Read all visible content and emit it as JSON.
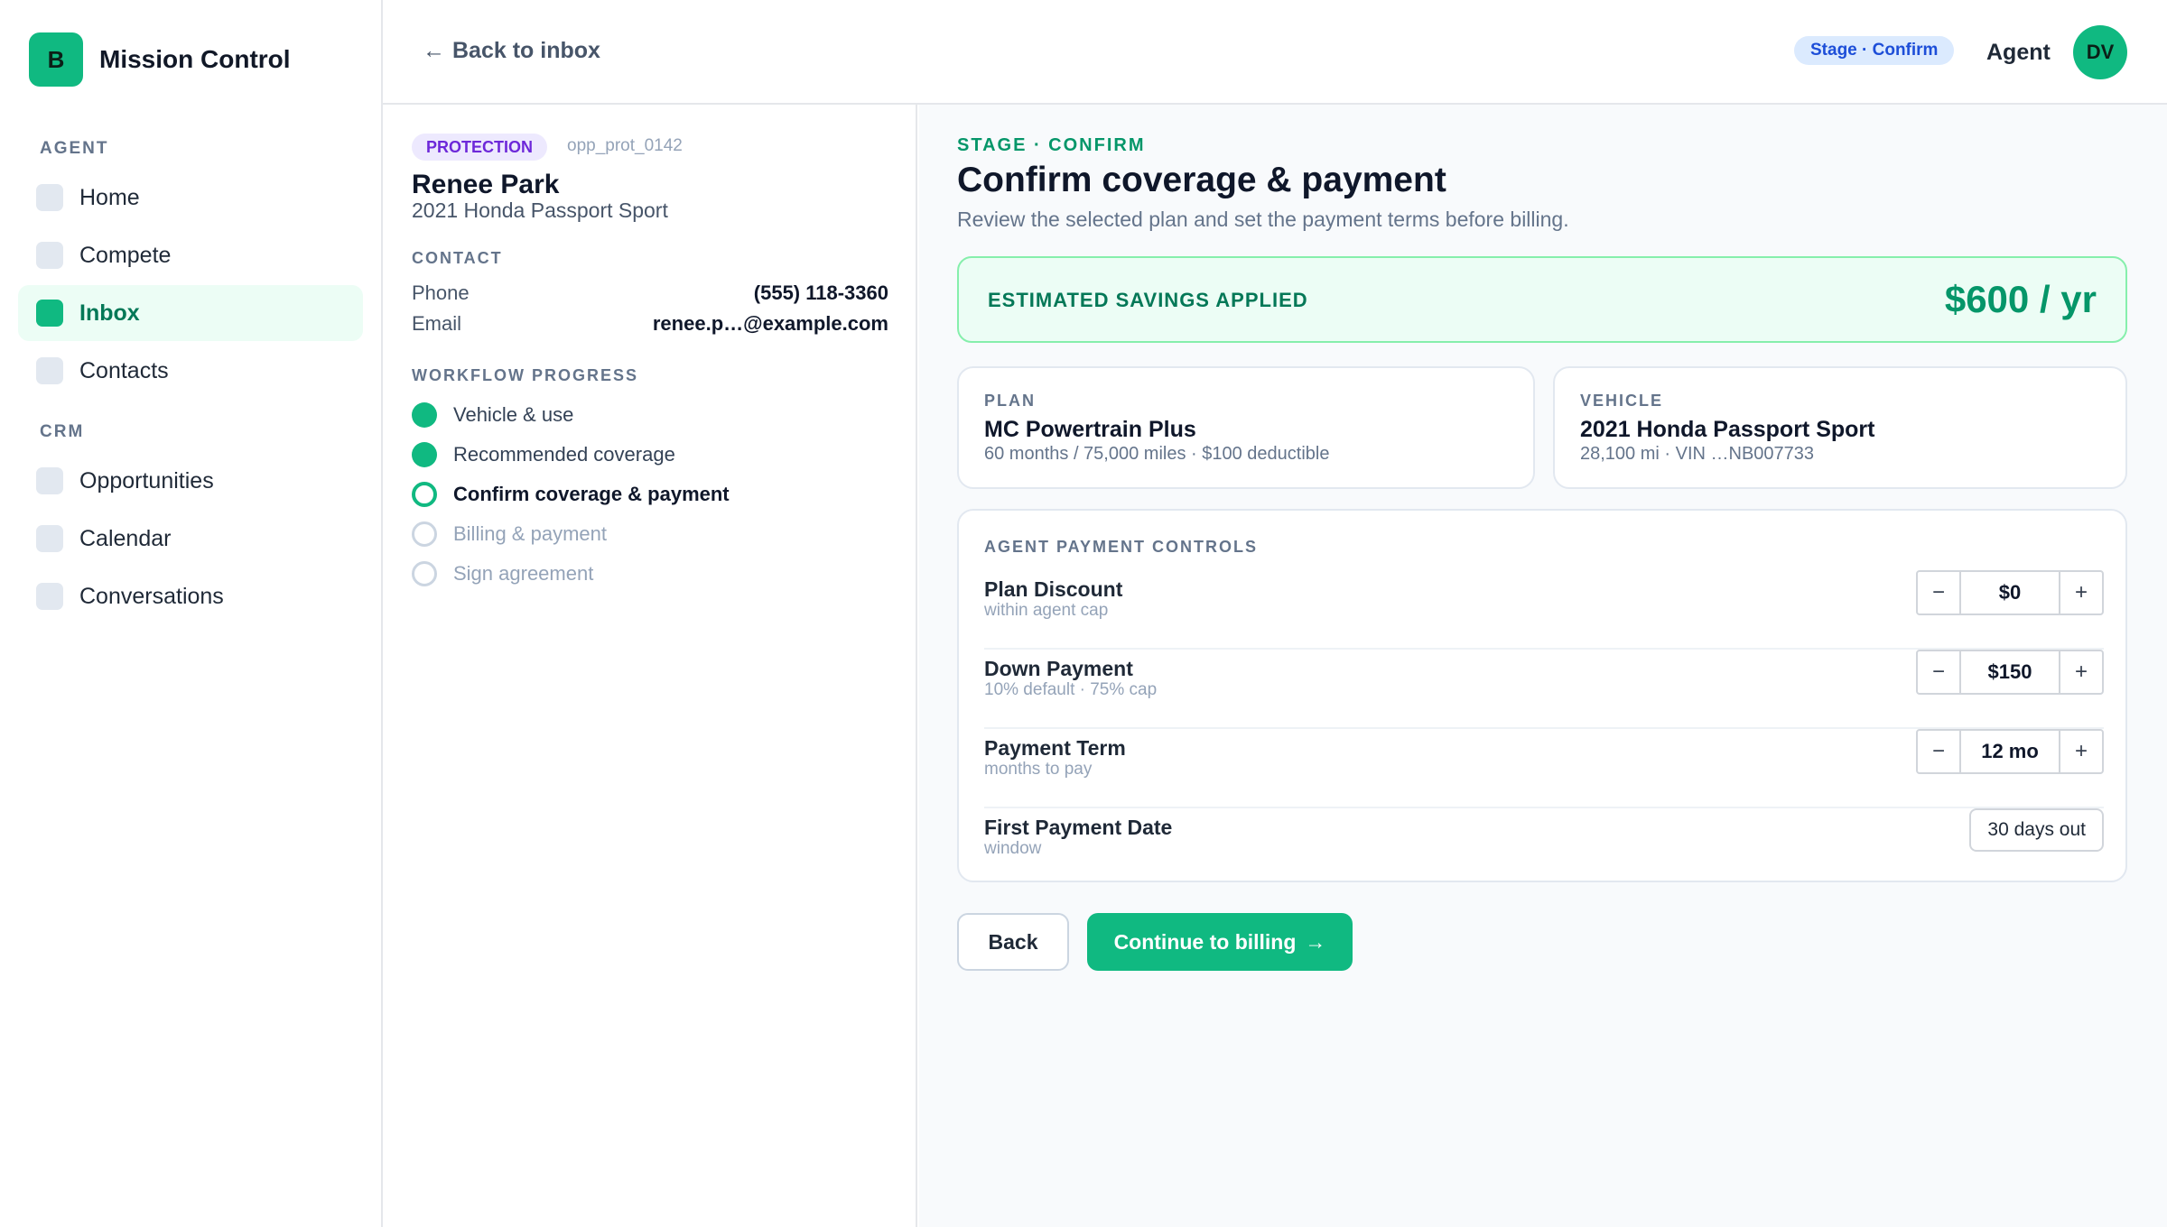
{
  "brand": {
    "logo": "B",
    "name": "Mission Control"
  },
  "nav": {
    "agent_section": "AGENT",
    "crm_section": "CRM",
    "items": [
      {
        "label": "Home"
      },
      {
        "label": "Compete"
      },
      {
        "label": "Inbox"
      },
      {
        "label": "Contacts"
      },
      {
        "label": "Opportunities"
      },
      {
        "label": "Calendar"
      },
      {
        "label": "Conversations"
      }
    ]
  },
  "topbar": {
    "back_label": "Back to inbox",
    "back_arrow": "←",
    "stage_pill": "Stage · Confirm",
    "agent_label": "Agent",
    "avatar": "DV"
  },
  "detail": {
    "tag": "PROTECTION",
    "opp_id": "opp_prot_0142",
    "name": "Renee Park",
    "vehicle": "2021 Honda Passport Sport",
    "contact_label": "CONTACT",
    "phone_label": "Phone",
    "phone": "(555) 118-3360",
    "email_label": "Email",
    "email": "renee.p…@example.com",
    "workflow_label": "WORKFLOW PROGRESS",
    "steps": [
      {
        "label": "Vehicle & use",
        "state": "done"
      },
      {
        "label": "Recommended coverage",
        "state": "done"
      },
      {
        "label": "Confirm coverage & payment",
        "state": "current"
      },
      {
        "label": "Billing & payment",
        "state": "todo"
      },
      {
        "label": "Sign agreement",
        "state": "todo"
      }
    ]
  },
  "main": {
    "eyebrow": "STAGE · CONFIRM",
    "title": "Confirm coverage & payment",
    "subtitle": "Review the selected plan and set the payment terms before billing.",
    "savings_label": "ESTIMATED SAVINGS APPLIED",
    "savings_amount": "$600 / yr",
    "plan": {
      "label": "PLAN",
      "title": "MC Powertrain Plus",
      "desc": "60 months / 75,000 miles · $100 deductible"
    },
    "vehicle": {
      "label": "VEHICLE",
      "title": "2021 Honda Passport Sport",
      "desc": "28,100 mi · VIN …NB007733"
    },
    "controls": {
      "label": "AGENT PAYMENT CONTROLS",
      "rows": [
        {
          "title": "Plan Discount",
          "sub": "within agent cap",
          "value": "$0"
        },
        {
          "title": "Down Payment",
          "sub": "10% default · 75% cap",
          "value": "$150"
        },
        {
          "title": "Payment Term",
          "sub": "months to pay",
          "value": "12 mo"
        }
      ],
      "first_payment": {
        "title": "First Payment Date",
        "sub": "window",
        "value": "30 days out"
      },
      "minus": "−",
      "plus": "+"
    },
    "back_button": "Back",
    "continue_button": "Continue to billing",
    "continue_arrow": "→"
  },
  "colors": {
    "accent": "#10b981",
    "accent_dark": "#047857",
    "tag_bg": "#ede9fe",
    "tag_fg": "#6d28d9",
    "pill_bg": "#dbeafe",
    "pill_fg": "#1d4ed8"
  }
}
